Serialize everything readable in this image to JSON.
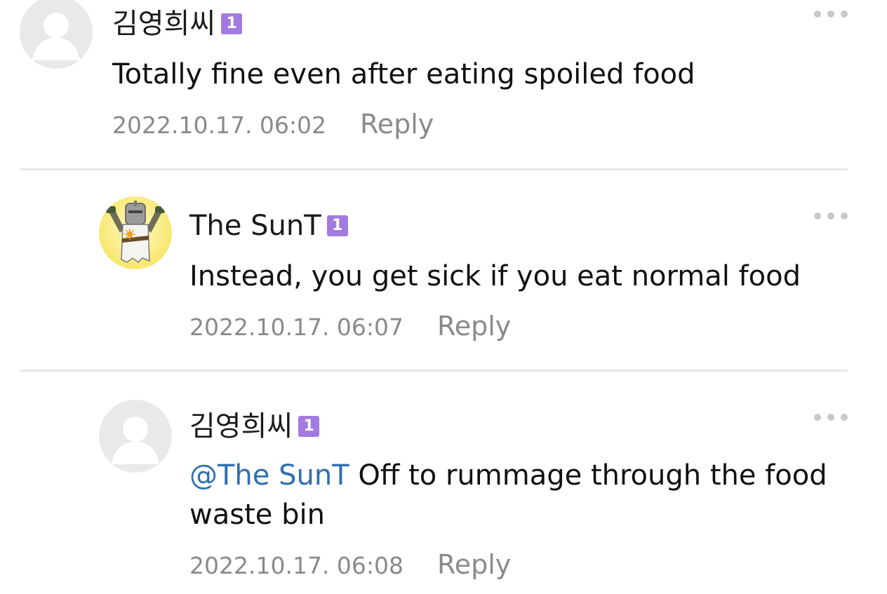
{
  "comments": [
    {
      "author": "김영희씨",
      "level": "1",
      "avatar_icon": "default-user-icon",
      "text": "Totally fine even after eating spoiled food",
      "mention": "",
      "timestamp": "2022.10.17. 06:02",
      "reply_label": "Reply"
    },
    {
      "author": "The SunT",
      "level": "1",
      "avatar_icon": "solaire-knight-icon",
      "text": "Instead, you get sick if you eat normal food",
      "mention": "",
      "timestamp": "2022.10.17. 06:07",
      "reply_label": "Reply"
    },
    {
      "author": "김영희씨",
      "level": "1",
      "avatar_icon": "default-user-icon",
      "mention": "@The SunT",
      "text": " Off to rummage through the food waste bin",
      "timestamp": "2022.10.17. 06:08",
      "reply_label": "Reply"
    }
  ],
  "colors": {
    "level_badge": "#a27be0",
    "mention": "#2f6fb3",
    "meta_text": "#8a8a8a",
    "divider": "#e6e6e6"
  },
  "icons": {
    "more": "more-options-icon"
  }
}
